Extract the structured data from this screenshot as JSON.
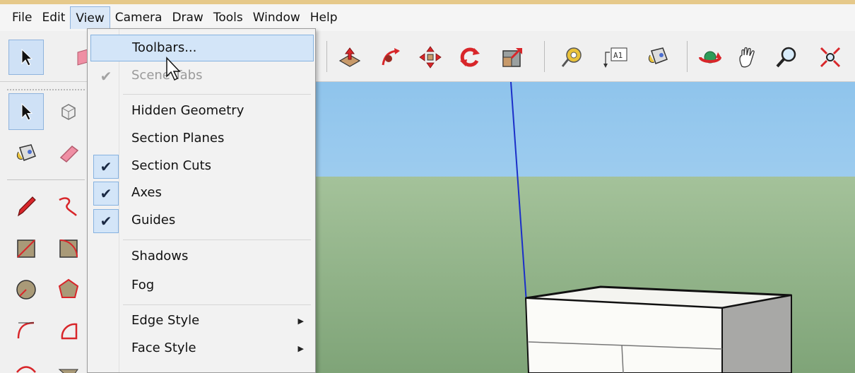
{
  "menubar": {
    "items": [
      "File",
      "Edit",
      "View",
      "Camera",
      "Draw",
      "Tools",
      "Window",
      "Help"
    ],
    "active": "View"
  },
  "view_menu": {
    "items": [
      {
        "label": "Toolbars...",
        "checked": false,
        "disabled": false,
        "submenu": false,
        "highlighted": true
      },
      {
        "label": "Scene Tabs",
        "checked": true,
        "disabled": true,
        "submenu": false,
        "highlighted": false
      },
      {
        "label": "Hidden Geometry",
        "checked": false,
        "disabled": false,
        "submenu": false,
        "highlighted": false
      },
      {
        "label": "Section Planes",
        "checked": false,
        "disabled": false,
        "submenu": false,
        "highlighted": false
      },
      {
        "label": "Section Cuts",
        "checked": true,
        "disabled": false,
        "submenu": false,
        "highlighted": false
      },
      {
        "label": "Axes",
        "checked": true,
        "disabled": false,
        "submenu": false,
        "highlighted": false
      },
      {
        "label": "Guides",
        "checked": true,
        "disabled": false,
        "submenu": false,
        "highlighted": false
      },
      {
        "label": "Shadows",
        "checked": false,
        "disabled": false,
        "submenu": false,
        "highlighted": false
      },
      {
        "label": "Fog",
        "checked": false,
        "disabled": false,
        "submenu": false,
        "highlighted": false
      },
      {
        "label": "Edge Style",
        "checked": false,
        "disabled": false,
        "submenu": true,
        "highlighted": false
      },
      {
        "label": "Face Style",
        "checked": false,
        "disabled": false,
        "submenu": true,
        "highlighted": false
      }
    ]
  },
  "toolbar": {
    "icons": [
      "select-icon",
      "eraser-icon",
      "push-pull-icon",
      "follow-me-icon",
      "move-icon",
      "rotate-icon",
      "scale-icon",
      "tape-measure-icon",
      "text-icon",
      "paint-bucket-icon",
      "orbit-icon",
      "pan-icon",
      "zoom-icon",
      "zoom-extents-icon"
    ],
    "text_icon_glyph": "A1"
  },
  "left_toolbar": {
    "icons": [
      "select-icon",
      "make-component-icon",
      "paint-bucket-icon",
      "eraser-icon",
      "pencil-icon",
      "freehand-icon",
      "rectangle-icon",
      "rotated-rectangle-icon",
      "circle-icon",
      "polygon-icon",
      "arc-icon",
      "pie-icon"
    ]
  },
  "colors": {
    "accent": "#d3e5f8",
    "accent_border": "#86b2e0",
    "sky": "#a5d2f1",
    "ground": "#90b389",
    "tool_red": "#d8262a"
  }
}
